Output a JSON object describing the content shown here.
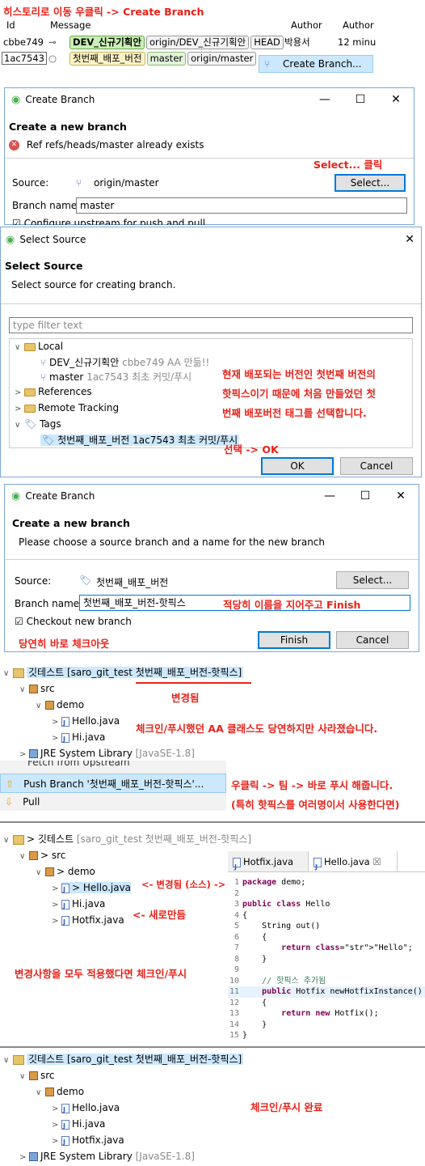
{
  "s1": {
    "note": "히스토리로 이동 우클릭 -> Create Branch",
    "cols": [
      "Id",
      "Message",
      "Author",
      "Author"
    ],
    "rows": [
      {
        "id": "cbbe749",
        "tags": [
          "DEV_신규기획안",
          "origin/DEV_신규기획안",
          "HEAD"
        ],
        "author": "박용서",
        "date": "12 minu"
      },
      {
        "id": "1ac7543",
        "tags": [
          "첫번째_배포_버전",
          "master",
          "origin/master"
        ]
      }
    ],
    "menu": "Create Branch..."
  },
  "d1": {
    "title": "Create Branch",
    "header": "Create a new branch",
    "error": "Ref refs/heads/master already exists",
    "note": "Select... 클릭",
    "source_label": "Source:",
    "source_value": "origin/master",
    "select_btn": "Select...",
    "branch_label": "Branch name:",
    "branch_value": "master",
    "upstream": "Configure upstream for push and pull"
  },
  "d2": {
    "title": "Select Source",
    "header": "Select Source",
    "desc": "Select source for creating branch.",
    "filter_placeholder": "type filter text",
    "local": "Local",
    "dev_branch": "DEV_신규기획안",
    "dev_info": "cbbe749 AA 만듦!!",
    "master_branch": "master",
    "master_info": "1ac7543 최초 커밋/푸시",
    "references": "References",
    "remote": "Remote Tracking",
    "tags": "Tags",
    "tag_item": "첫번째_배포_버전 1ac7543 최초 커밋/푸시",
    "note_lines": [
      "현재 배포되는 버전인 첫번째 버전의",
      "핫픽스이기 때문에 처음 만들었던 첫",
      "번째 배포버전 태그를 선택합니다."
    ],
    "note2": "선택 -> OK",
    "ok": "OK",
    "cancel": "Cancel"
  },
  "d3": {
    "title": "Create Branch",
    "header": "Create a new branch",
    "desc": "Please choose a source branch and a name for the new branch",
    "source_label": "Source:",
    "source_value": "첫번째_배포_버전",
    "select_btn": "Select...",
    "branch_label": "Branch name:",
    "branch_value": "첫번째_배포_버전-핫픽스",
    "note": "적당히 이름을 지어주고 Finish",
    "checkout": "Checkout new branch",
    "note2": "당연히 바로 체크아웃",
    "finish": "Finish",
    "cancel": "Cancel"
  },
  "s5": {
    "project": "깃테스트 [saro_git_test 첫번째_배포_버전-핫픽스]",
    "note_changed": "변경됨",
    "src": "src",
    "demo": "demo",
    "hello": "Hello.java",
    "hi": "Hi.java",
    "note_gone": "체크인/푸시했던 AA 클래스도 당연하지만 사라졌습니다.",
    "jre": "JRE System Library",
    "jre_ver": "[JavaSE-1.8]"
  },
  "s6": {
    "fetch": "Fetch from Upstream",
    "push": "Push Branch '첫번째_배포_버전-핫픽스'...",
    "pull": "Pull",
    "note1": "우클릭 -> 팀 -> 바로 푸시 해줍니다.",
    "note2": "(특히 핫픽스를 여러명이서 사용한다면)"
  },
  "s7": {
    "project": "> 깃테스트",
    "project_info": "[saro_git_test 첫번째_배포_버전-핫픽스]",
    "src": "> src",
    "demo": "> demo",
    "hello": "> Hello.java",
    "hi": "Hi.java",
    "hotfix": "Hotfix.java",
    "note_changed": "<- 변경됨 (소스) ->",
    "note_new": "<- 새로만듬",
    "note_apply": "변경사항을 모두 적용했다면 체크인/푸시",
    "tab1": "Hotfix.java",
    "tab2": "Hello.java",
    "code": [
      {
        "n": "1",
        "t": "package demo;"
      },
      {
        "n": "2",
        "t": ""
      },
      {
        "n": "3",
        "t": "public class Hello"
      },
      {
        "n": "4",
        "t": "{"
      },
      {
        "n": "5",
        "t": "    String out()"
      },
      {
        "n": "6",
        "t": "    {"
      },
      {
        "n": "7",
        "t": "        return \"Hello\";"
      },
      {
        "n": "8",
        "t": "    }"
      },
      {
        "n": "9",
        "t": ""
      },
      {
        "n": "10",
        "t": "    // 핫픽스 추가됨"
      },
      {
        "n": "11",
        "t": "    public Hotfix newHotfixInstance()"
      },
      {
        "n": "12",
        "t": "    {"
      },
      {
        "n": "13",
        "t": "        return new Hotfix();"
      },
      {
        "n": "14",
        "t": "    }"
      },
      {
        "n": "15",
        "t": "}"
      }
    ]
  },
  "s8": {
    "project": "깃테스트 [saro_git_test 첫번째_배포_버전-핫픽스]",
    "src": "src",
    "demo": "demo",
    "hello": "Hello.java",
    "hi": "Hi.java",
    "hotfix": "Hotfix.java",
    "jre": "JRE System Library",
    "jre_ver": "[JavaSE-1.8]",
    "note": "체크인/푸시 완료"
  }
}
